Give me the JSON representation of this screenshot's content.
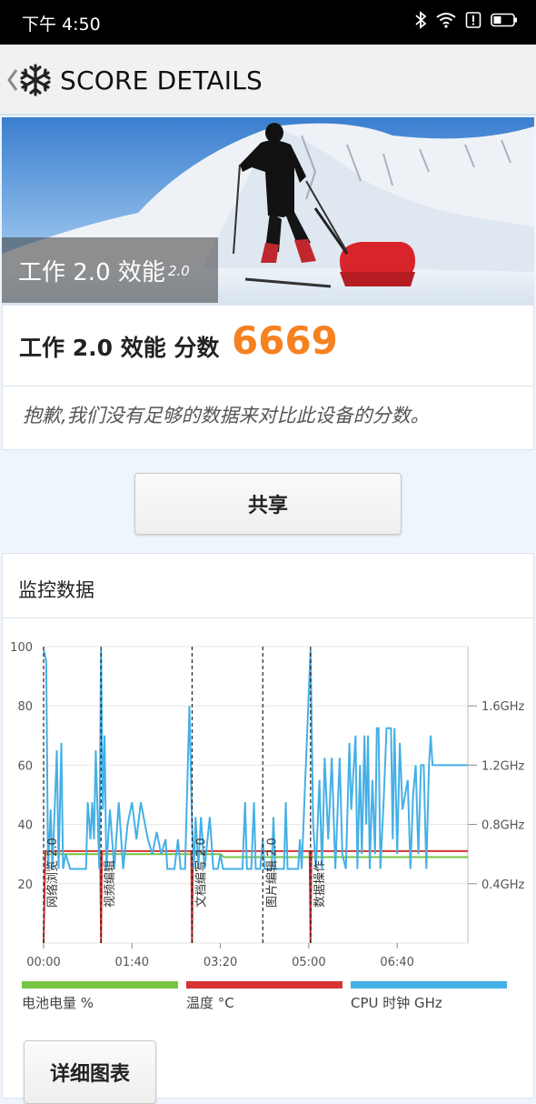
{
  "status_bar": {
    "time": "下午 4:50"
  },
  "app_bar": {
    "title": "SCORE DETAILS"
  },
  "hero": {
    "title": "工作 2.0 效能",
    "version": "2.0"
  },
  "score": {
    "label": "工作 2.0 效能 分数",
    "value": "6669",
    "note": "抱歉,我们没有足够的数据来对比此设备的分数。"
  },
  "share_button": "共享",
  "monitor": {
    "title": "监控数据"
  },
  "chart_data": {
    "type": "line",
    "x_ticks": [
      "00:00",
      "01:40",
      "03:20",
      "05:00",
      "06:40"
    ],
    "y_left_ticks": [
      "20",
      "40",
      "60",
      "80",
      "100"
    ],
    "y_right_ticks": [
      "0.4GHz",
      "0.8GHz",
      "1.2GHz",
      "1.6GHz"
    ],
    "x_range_seconds": [
      0,
      480
    ],
    "y_left_range": [
      0,
      100
    ],
    "y_right_range_ghz": [
      0,
      2.0
    ],
    "markers": [
      {
        "label": "网络浏览 2.0",
        "x": 0
      },
      {
        "label": "视频编辑",
        "x": 65
      },
      {
        "label": "文档编写 2.0",
        "x": 168
      },
      {
        "label": "图片编辑 2.0",
        "x": 248
      },
      {
        "label": "数据操作",
        "x": 302
      }
    ],
    "series": [
      {
        "name": "电池电量 %",
        "color": "#76c442",
        "points": [
          [
            0,
            30
          ],
          [
            200,
            30
          ],
          [
            204,
            29
          ],
          [
            480,
            29
          ]
        ]
      },
      {
        "name": "温度 °C",
        "color": "#d63333",
        "points": [
          [
            0,
            0
          ],
          [
            2,
            31
          ],
          [
            64,
            31
          ],
          [
            65,
            0
          ],
          [
            66,
            31
          ],
          [
            167,
            31
          ],
          [
            168,
            0
          ],
          [
            169,
            31
          ],
          [
            301,
            31
          ],
          [
            302,
            0
          ],
          [
            303,
            31
          ],
          [
            480,
            31
          ]
        ]
      },
      {
        "name": "CPU 时钟 GHz",
        "color": "#45b0e6",
        "points": [
          [
            0,
            1.98
          ],
          [
            3,
            1.9
          ],
          [
            5,
            0.5
          ],
          [
            8,
            0.9
          ],
          [
            10,
            0.5
          ],
          [
            15,
            1.3
          ],
          [
            17,
            0.5
          ],
          [
            20,
            1.35
          ],
          [
            22,
            0.5
          ],
          [
            25,
            0.6
          ],
          [
            30,
            0.5
          ],
          [
            48,
            0.5
          ],
          [
            50,
            0.95
          ],
          [
            53,
            0.7
          ],
          [
            55,
            0.95
          ],
          [
            57,
            0.7
          ],
          [
            59,
            1.3
          ],
          [
            61,
            0.9
          ],
          [
            63,
            0.5
          ],
          [
            65,
            1.98
          ],
          [
            67,
            0.9
          ],
          [
            69,
            1.4
          ],
          [
            71,
            0.5
          ],
          [
            75,
            0.9
          ],
          [
            80,
            0.5
          ],
          [
            85,
            0.95
          ],
          [
            90,
            0.5
          ],
          [
            95,
            0.8
          ],
          [
            100,
            0.95
          ],
          [
            105,
            0.7
          ],
          [
            110,
            0.95
          ],
          [
            118,
            0.7
          ],
          [
            123,
            0.6
          ],
          [
            128,
            0.75
          ],
          [
            133,
            0.6
          ],
          [
            138,
            0.7
          ],
          [
            140,
            0.5
          ],
          [
            148,
            0.5
          ],
          [
            152,
            0.7
          ],
          [
            155,
            0.5
          ],
          [
            160,
            0.5
          ],
          [
            165,
            1.6
          ],
          [
            168,
            0.8
          ],
          [
            170,
            0.5
          ],
          [
            172,
            0.85
          ],
          [
            175,
            0.5
          ],
          [
            178,
            0.85
          ],
          [
            182,
            0.5
          ],
          [
            188,
            0.85
          ],
          [
            192,
            0.5
          ],
          [
            197,
            0.5
          ],
          [
            200,
            0.6
          ],
          [
            203,
            0.5
          ],
          [
            225,
            0.5
          ],
          [
            228,
            0.95
          ],
          [
            230,
            0.5
          ],
          [
            235,
            0.5
          ],
          [
            238,
            0.95
          ],
          [
            240,
            0.5
          ],
          [
            245,
            0.5
          ],
          [
            248,
            0.7
          ],
          [
            250,
            0.5
          ],
          [
            258,
            0.5
          ],
          [
            260,
            0.85
          ],
          [
            262,
            0.5
          ],
          [
            272,
            0.5
          ],
          [
            274,
            0.95
          ],
          [
            276,
            0.5
          ],
          [
            288,
            0.5
          ],
          [
            290,
            0.7
          ],
          [
            292,
            0.5
          ],
          [
            302,
            1.98
          ],
          [
            305,
            0.8
          ],
          [
            308,
            0.5
          ],
          [
            312,
            1.1
          ],
          [
            315,
            0.5
          ],
          [
            318,
            1.25
          ],
          [
            322,
            0.7
          ],
          [
            326,
            1.25
          ],
          [
            330,
            0.5
          ],
          [
            335,
            1.25
          ],
          [
            338,
            0.6
          ],
          [
            342,
            0.5
          ],
          [
            346,
            1.35
          ],
          [
            348,
            0.9
          ],
          [
            351,
            1.2
          ],
          [
            353,
            1.4
          ],
          [
            355,
            0.5
          ],
          [
            358,
            1.2
          ],
          [
            360,
            0.6
          ],
          [
            363,
            1.4
          ],
          [
            365,
            0.8
          ],
          [
            367,
            1.4
          ],
          [
            369,
            0.5
          ],
          [
            372,
            1.1
          ],
          [
            375,
            0.6
          ],
          [
            377,
            1.45
          ],
          [
            379,
            1.45
          ],
          [
            381,
            0.5
          ],
          [
            385,
            1.0
          ],
          [
            388,
            1.45
          ],
          [
            391,
            1.45
          ],
          [
            393,
            1.45
          ],
          [
            395,
            0.7
          ],
          [
            397,
            1.45
          ],
          [
            400,
            0.6
          ],
          [
            403,
            1.35
          ],
          [
            406,
            0.9
          ],
          [
            409,
            1.0
          ],
          [
            412,
            1.1
          ],
          [
            415,
            0.5
          ],
          [
            418,
            1.0
          ],
          [
            421,
            1.2
          ],
          [
            424,
            0.6
          ],
          [
            427,
            1.2
          ],
          [
            430,
            1.2
          ],
          [
            433,
            0.5
          ],
          [
            436,
            1.2
          ],
          [
            438,
            1.4
          ],
          [
            440,
            1.2
          ],
          [
            442,
            1.2
          ],
          [
            446,
            1.2
          ],
          [
            480,
            1.2
          ]
        ]
      }
    ]
  },
  "legend": [
    {
      "label": "电池电量 %",
      "color": "#76c442"
    },
    {
      "label": "温度 °C",
      "color": "#d63333"
    },
    {
      "label": "CPU 时钟 GHz",
      "color": "#45b0e6"
    }
  ],
  "detail_button": "详细图表"
}
